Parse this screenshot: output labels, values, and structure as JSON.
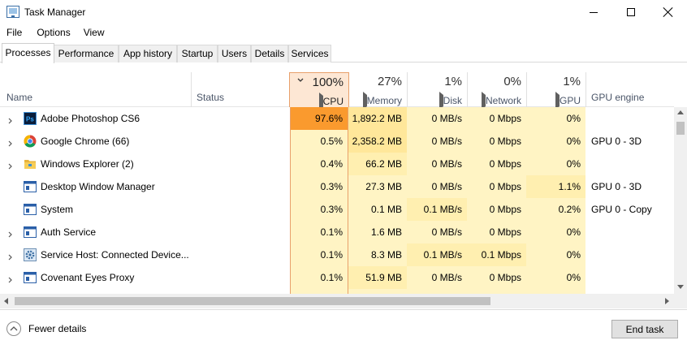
{
  "window": {
    "title": "Task Manager",
    "icon": "task-manager-icon"
  },
  "menu": [
    "File",
    "Options",
    "View"
  ],
  "tabs": [
    {
      "label": "Processes",
      "active": true
    },
    {
      "label": "Performance"
    },
    {
      "label": "App history"
    },
    {
      "label": "Startup"
    },
    {
      "label": "Users"
    },
    {
      "label": "Details"
    },
    {
      "label": "Services"
    }
  ],
  "columns": {
    "name": "Name",
    "status": "Status",
    "cpu": {
      "pct": "100%",
      "label": "CPU",
      "sorted": "descending"
    },
    "memory": {
      "pct": "27%",
      "label": "Memory"
    },
    "disk": {
      "pct": "1%",
      "label": "Disk"
    },
    "network": {
      "pct": "0%",
      "label": "Network"
    },
    "gpu": {
      "pct": "1%",
      "label": "GPU"
    },
    "gpu_engine": "GPU engine"
  },
  "processes": [
    {
      "name": "Adobe Photoshop CS6",
      "icon": "photoshop-icon",
      "expandable": true,
      "cpu": "97.6%",
      "memory": "1,892.2 MB",
      "disk": "0 MB/s",
      "network": "0 Mbps",
      "gpu": "0%",
      "gpu_engine": ""
    },
    {
      "name": "Google Chrome (66)",
      "icon": "chrome-icon",
      "expandable": true,
      "cpu": "0.5%",
      "memory": "2,358.2 MB",
      "disk": "0 MB/s",
      "network": "0 Mbps",
      "gpu": "0%",
      "gpu_engine": "GPU 0 - 3D"
    },
    {
      "name": "Windows Explorer (2)",
      "icon": "folder-icon",
      "expandable": true,
      "cpu": "0.4%",
      "memory": "66.2 MB",
      "disk": "0 MB/s",
      "network": "0 Mbps",
      "gpu": "0%",
      "gpu_engine": ""
    },
    {
      "name": "Desktop Window Manager",
      "icon": "window-app-icon",
      "expandable": false,
      "cpu": "0.3%",
      "memory": "27.3 MB",
      "disk": "0 MB/s",
      "network": "0 Mbps",
      "gpu": "1.1%",
      "gpu_engine": "GPU 0 - 3D"
    },
    {
      "name": "System",
      "icon": "window-app-icon",
      "expandable": false,
      "cpu": "0.3%",
      "memory": "0.1 MB",
      "disk": "0.1 MB/s",
      "network": "0 Mbps",
      "gpu": "0.2%",
      "gpu_engine": "GPU 0 - Copy"
    },
    {
      "name": "Auth Service",
      "icon": "window-app-icon",
      "expandable": true,
      "cpu": "0.1%",
      "memory": "1.6 MB",
      "disk": "0 MB/s",
      "network": "0 Mbps",
      "gpu": "0%",
      "gpu_engine": ""
    },
    {
      "name": "Service Host: Connected Device...",
      "icon": "gear-icon",
      "expandable": true,
      "cpu": "0.1%",
      "memory": "8.3 MB",
      "disk": "0.1 MB/s",
      "network": "0.1 Mbps",
      "gpu": "0%",
      "gpu_engine": ""
    },
    {
      "name": "Covenant Eyes Proxy",
      "icon": "window-app-icon",
      "expandable": true,
      "cpu": "0.1%",
      "memory": "51.9 MB",
      "disk": "0 MB/s",
      "network": "0 Mbps",
      "gpu": "0%",
      "gpu_engine": ""
    }
  ],
  "footer": {
    "fewer_details": "Fewer details",
    "end_task": "End task"
  },
  "colors": {
    "cpu_hot": "#fa9a2e",
    "heat_light": "#fff4c4",
    "heat_mid": "#ffefb0",
    "heat_strong": "#ffe79a",
    "cpu_header": "#fde7d4"
  }
}
